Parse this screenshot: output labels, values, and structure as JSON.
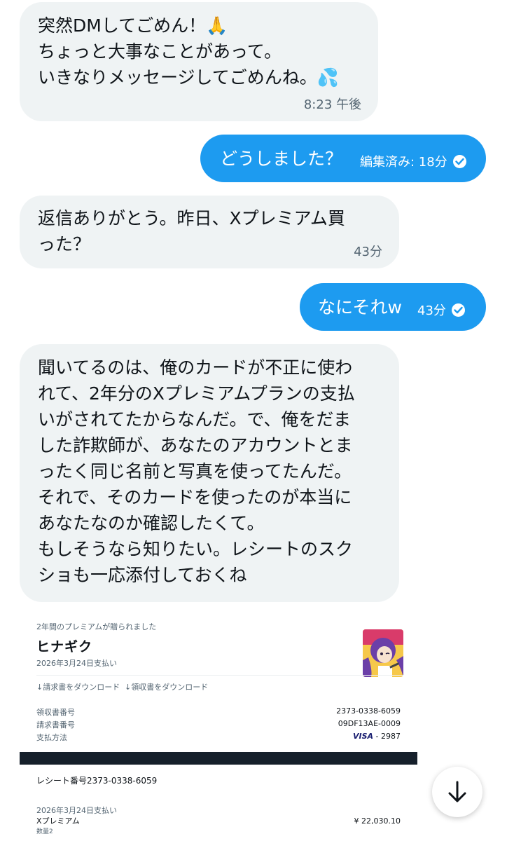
{
  "messages": [
    {
      "text": "突然DMしてごめん！🙏\nちょっと大事なことがあって。\nいきなりメッセージしてごめんね。💦",
      "time": "8:23 午後"
    },
    {
      "text": "どうしました？",
      "edited": "編集済み: 18分"
    },
    {
      "text": "返信ありがとう。昨日、Xプレミアム買\nった？",
      "time": "43分"
    },
    {
      "text": "なにそれw",
      "time": "43分"
    },
    {
      "text": "聞いてるのは、俺のカードが不正に使わ\nれて、2年分のXプレミアムプランの支払\nいがされてたからなんだ。で、俺をだま\nした詐欺師が、あなたのアカウントとま\nったく同じ名前と写真を使ってたんだ。\nそれで、そのカードを使ったのが本当に\nあなたなのか確認したくて。\nもしそうなら知りたい。レシートのスク\nショも一応添付しておくね"
    }
  ],
  "receipt": {
    "header": "2年間のプレミアムが贈られました",
    "name": "ヒナギク",
    "paid_date": "2026年3月24日支払い",
    "download_invoice": "↓請求書をダウンロード",
    "download_receipt": "↓領収書をダウンロード",
    "rows": [
      {
        "label": "領収書番号",
        "value": "2373-0338-6059"
      },
      {
        "label": "請求書番号",
        "value": "09DF13AE-0009"
      },
      {
        "label": "支払方法",
        "value_brand": "VISA",
        "value": "- 2987"
      }
    ],
    "receipt_no": "レシート番号2373-0338-6059",
    "paid_date2": "2026年3月24日支払い",
    "item": "Xプレミアム",
    "item_sub": "数量2",
    "price": "¥ 22,030.10"
  },
  "colors": {
    "accent": "#1d9bf0",
    "bubble_recv": "#eff3f4",
    "dark_band": "#16202b"
  }
}
